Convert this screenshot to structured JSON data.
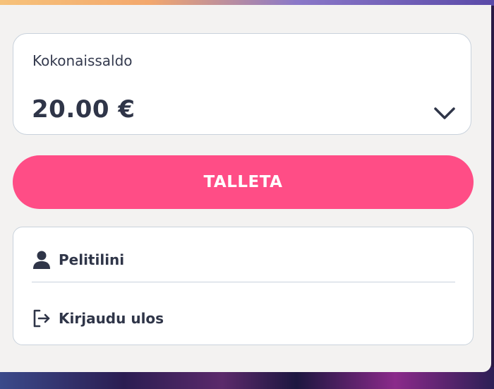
{
  "balance": {
    "label": "Kokonaissaldo",
    "amount": "20.00 €",
    "expand_icon": "chevron-down-icon"
  },
  "deposit": {
    "label": "TALLETA",
    "color": "#ff4d86"
  },
  "menu": {
    "items": [
      {
        "label": "Pelitilini",
        "icon": "user-icon"
      },
      {
        "label": "Kirjaudu ulos",
        "icon": "logout-icon"
      }
    ]
  },
  "colors": {
    "text": "#2f3548",
    "panel": "#f3f2f1",
    "border": "#c9d2dc"
  }
}
